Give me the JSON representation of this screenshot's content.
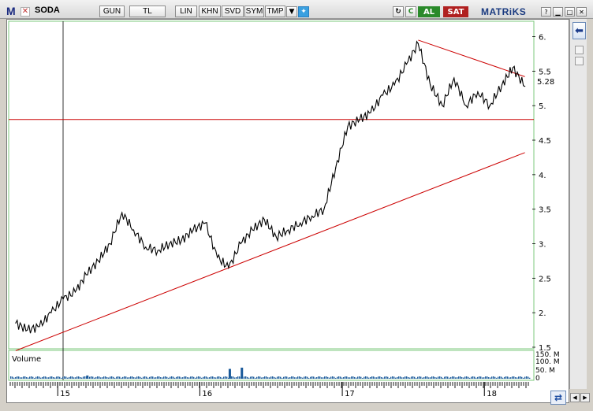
{
  "toolbar": {
    "app_logo": "M",
    "symbol": "SODA",
    "buttons": [
      "GUN",
      "TL",
      "LIN",
      "KHN",
      "SVD",
      "SYM",
      "TMP"
    ],
    "buy_label": "AL",
    "sell_label": "SAT",
    "brand": "MATRiKS",
    "icons": [
      "close-icon",
      "dropdown-arrow-icon",
      "twitter-icon",
      "refresh-icon",
      "c-icon",
      "back-arrow-icon"
    ]
  },
  "chart": {
    "volume_label": "Volume",
    "price_ticks": [
      "6.",
      "5.5",
      "5.",
      "4.5",
      "4.",
      "3.5",
      "3.",
      "2.5",
      "2.",
      "1.5"
    ],
    "last_price": "5.28",
    "volume_ticks": [
      "150. M",
      "100. M",
      "50. M",
      "0"
    ],
    "x_ticks": [
      "15",
      "16",
      "17",
      "18"
    ]
  },
  "chart_data": {
    "type": "line",
    "title": "SODA",
    "series": [
      {
        "x": [
          "2014-09",
          "2014-10",
          "2014-11",
          "2014-12",
          "2015-01",
          "2015-02",
          "2015-03",
          "2015-04",
          "2015-05",
          "2015-06",
          "2015-07",
          "2015-08",
          "2015-09",
          "2015-10",
          "2015-11",
          "2015-12",
          "2016-01",
          "2016-02",
          "2016-03",
          "2016-04",
          "2016-05",
          "2016-06",
          "2016-07",
          "2016-08",
          "2016-09",
          "2016-10",
          "2016-11",
          "2016-12",
          "2017-01",
          "2017-02",
          "2017-03",
          "2017-04",
          "2017-05",
          "2017-06",
          "2017-07",
          "2017-08",
          "2017-09",
          "2017-10",
          "2017-11",
          "2017-12",
          "2018-01",
          "2018-02",
          "2018-03",
          "2018-04"
        ],
        "values": [
          1.85,
          1.75,
          1.8,
          2.0,
          2.2,
          2.3,
          2.55,
          2.75,
          3.0,
          3.45,
          3.2,
          2.95,
          2.9,
          3.0,
          3.05,
          3.2,
          3.3,
          2.8,
          2.65,
          3.0,
          3.2,
          3.35,
          3.1,
          3.2,
          3.3,
          3.4,
          3.5,
          4.1,
          4.7,
          4.8,
          4.9,
          5.15,
          5.3,
          5.6,
          5.9,
          5.3,
          5.0,
          5.4,
          5.0,
          5.2,
          5.0,
          5.3,
          5.55,
          5.28
        ]
      }
    ],
    "volume": {
      "x": [
        "2015-03",
        "2016-03",
        "2016-04"
      ],
      "values": [
        18,
        55,
        62
      ]
    },
    "ylim": [
      1.5,
      6.2
    ],
    "volume_ylim": [
      0,
      150
    ],
    "horizontal_lines": [
      4.8
    ],
    "trendlines": [
      {
        "x": [
          "2014-09",
          "2018-04"
        ],
        "values": [
          1.45,
          4.32
        ]
      },
      {
        "x": [
          "2017-07",
          "2018-04"
        ],
        "values": [
          5.95,
          5.42
        ]
      }
    ],
    "grid": false,
    "colors": {
      "price": "#000000",
      "trendline": "#cc0000",
      "volume": "#1a5a9a",
      "panel_border": "#7cc87c"
    }
  }
}
